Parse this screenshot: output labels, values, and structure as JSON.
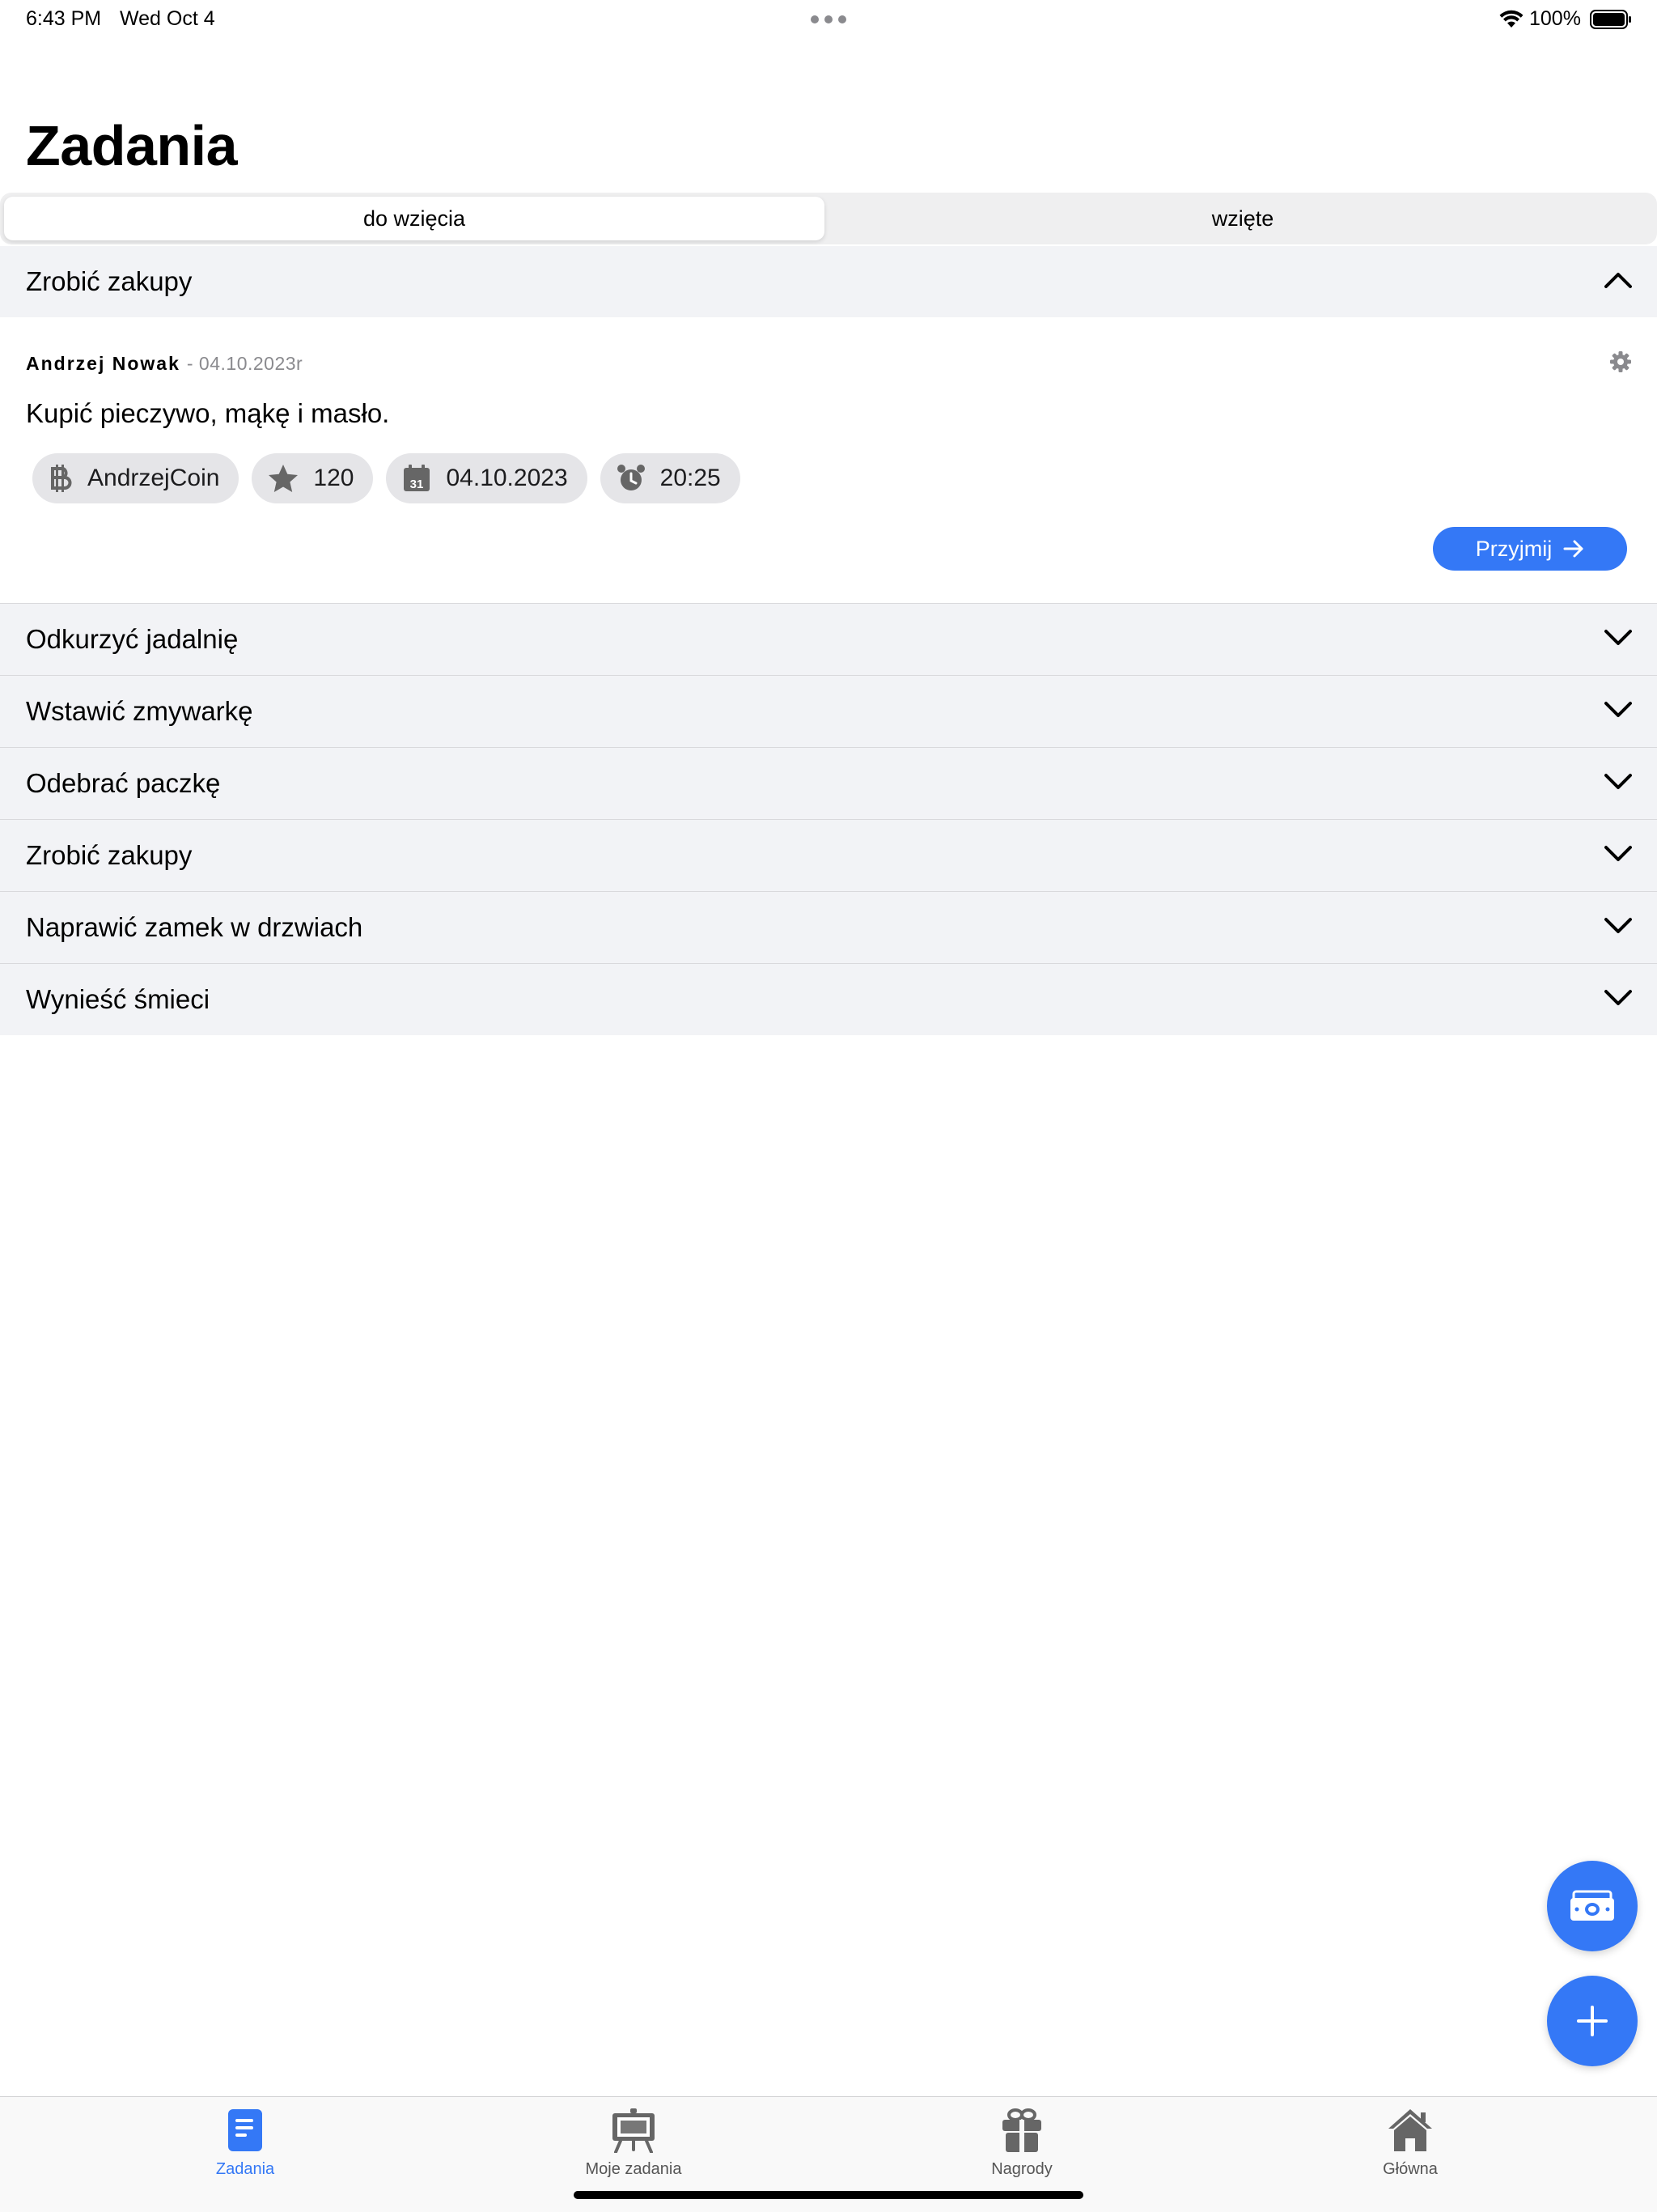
{
  "status_bar": {
    "time": "6:43 PM",
    "date": "Wed Oct 4",
    "battery": "100%"
  },
  "page_title": "Zadania",
  "segments": [
    {
      "label": "do wzięcia",
      "selected": true
    },
    {
      "label": "wzięte",
      "selected": false
    }
  ],
  "expanded_task": {
    "title": "Zrobić zakupy",
    "author": "Andrzej Nowak",
    "date": "- 04.10.2023r",
    "description": "Kupić pieczywo, mąkę i masło.",
    "chips": {
      "currency": "AndrzejCoin",
      "points": "120",
      "due_date": "04.10.2023",
      "due_time": "20:25"
    },
    "accept_label": "Przyjmij"
  },
  "tasks": [
    "Odkurzyć jadalnię",
    "Wstawić zmywarkę",
    "Odebrać paczkę",
    "Zrobić zakupy",
    "Naprawić zamek w drzwiach",
    "Wynieść śmieci"
  ],
  "tabs": [
    {
      "label": "Zadania",
      "icon": "document-icon",
      "active": true
    },
    {
      "label": "Moje zadania",
      "icon": "easel-icon",
      "active": false
    },
    {
      "label": "Nagrody",
      "icon": "gift-icon",
      "active": false
    },
    {
      "label": "Główna",
      "icon": "house-icon",
      "active": false
    }
  ],
  "colors": {
    "accent": "#3478f6",
    "header_bg": "#f2f3f6",
    "chip_bg": "#e5e5e8"
  }
}
